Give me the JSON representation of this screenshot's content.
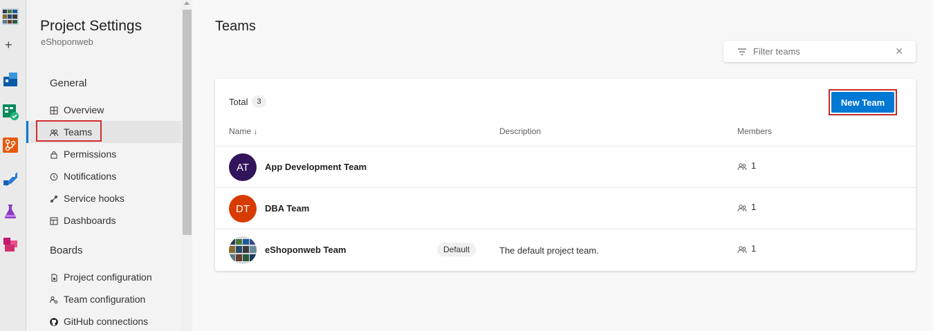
{
  "sidebar": {
    "title": "Project Settings",
    "project": "eShoponweb",
    "sections": [
      {
        "label": "General",
        "items": [
          {
            "label": "Overview",
            "icon": "overview-icon"
          },
          {
            "label": "Teams",
            "icon": "teams-icon",
            "selected": true
          },
          {
            "label": "Permissions",
            "icon": "lock-icon"
          },
          {
            "label": "Notifications",
            "icon": "notification-icon"
          },
          {
            "label": "Service hooks",
            "icon": "service-hooks-icon"
          },
          {
            "label": "Dashboards",
            "icon": "dashboard-icon"
          }
        ]
      },
      {
        "label": "Boards",
        "items": [
          {
            "label": "Project configuration",
            "icon": "project-config-icon"
          },
          {
            "label": "Team configuration",
            "icon": "team-config-icon"
          },
          {
            "label": "GitHub connections",
            "icon": "github-icon"
          }
        ]
      }
    ]
  },
  "main": {
    "title": "Teams",
    "filter": {
      "placeholder": "Filter teams",
      "value": ""
    },
    "total_label": "Total",
    "total_count": "3",
    "new_team_label": "New Team",
    "columns": {
      "name": "Name ↓",
      "description": "Description",
      "members": "Members"
    },
    "teams": [
      {
        "initials": "AT",
        "name": "App Development Team",
        "badge": "",
        "description": "",
        "members": "1",
        "color": "#32145a"
      },
      {
        "initials": "DT",
        "name": "DBA Team",
        "badge": "",
        "description": "",
        "members": "1",
        "color": "#d83b01"
      },
      {
        "initials": "",
        "name": "eShoponweb Team",
        "badge": "Default",
        "description": "The default project team.",
        "members": "1",
        "color": "#2b6e8a"
      }
    ]
  },
  "colors": {
    "accent": "#0078d4",
    "highlight": "#d42b2b"
  }
}
